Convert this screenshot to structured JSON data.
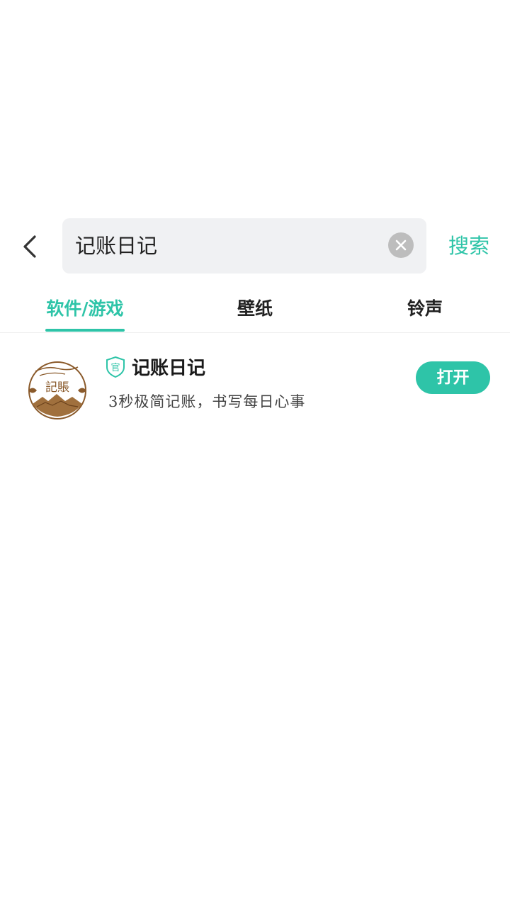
{
  "search": {
    "query": "记账日记",
    "search_label": "搜索"
  },
  "tabs": [
    {
      "label": "软件/游戏",
      "active": true
    },
    {
      "label": "壁纸",
      "active": false
    },
    {
      "label": "铃声",
      "active": false
    }
  ],
  "results": [
    {
      "name": "记账日记",
      "badge": "官",
      "description": "3秒极简记账，书写每日心事",
      "action_label": "打开",
      "icon_text": "記賬"
    }
  ],
  "colors": {
    "accent": "#2ec4a8",
    "icon_brown": "#8a5a2b"
  }
}
